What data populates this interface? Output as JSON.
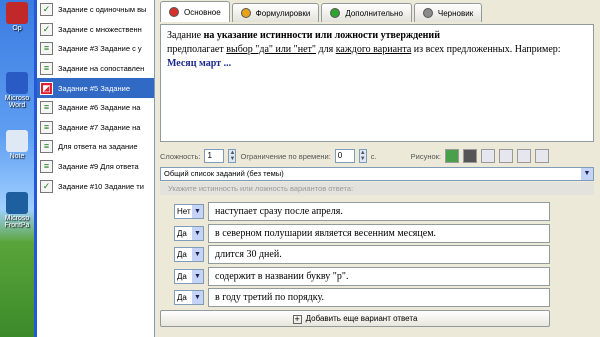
{
  "desktop": {
    "icons": [
      {
        "label": "Op"
      },
      {
        "label": "Microso Word"
      },
      {
        "label": "Note"
      },
      {
        "label": "Microso FrontPa"
      }
    ]
  },
  "task_list": {
    "items": [
      {
        "label": "Задание с одиночным вы"
      },
      {
        "label": "Задание с множественн"
      },
      {
        "label": "Задание #3 Задание с у"
      },
      {
        "label": "Задание на сопоставлен"
      },
      {
        "label": "Задание #5 Задание",
        "selected": true
      },
      {
        "label": "Задание #6 Задание на"
      },
      {
        "label": "Задание #7 Задание на"
      },
      {
        "label": "Для ответа на задание"
      },
      {
        "label": "Задание #9 Для ответа"
      },
      {
        "label": "Задание #10 Задание ти"
      }
    ]
  },
  "tabs": [
    {
      "label": "Основное",
      "color": "#d8302a",
      "active": true
    },
    {
      "label": "Формулировки",
      "color": "#e8a21a"
    },
    {
      "label": "Дополнительно",
      "color": "#2fa32f"
    },
    {
      "label": "Черновик",
      "color": "#8a8a8a"
    }
  ],
  "editor": {
    "p1": "Задание ",
    "p1_bold": "на указание истинности или ложности утверждений",
    "p2": " предполагает ",
    "p2_u1": "выбор \"да\" или \"нет\"",
    "p3": " для ",
    "p3_u2": "каждого варианта",
    "p4": " из всех предложенных. Например:",
    "example": "Месяц март ..."
  },
  "props": {
    "complexity_label": "Сложность:",
    "complexity_value": "1",
    "time_limit_label": "Ограничение по времени:",
    "time_value": "0",
    "seconds_label": "с.",
    "picture_label": "Рисунок:"
  },
  "topic_select": {
    "value": "Общий список заданий (без темы)"
  },
  "hint": "Укажите истинность или ложность вариантов ответа:",
  "answers": [
    {
      "choice": "Нет",
      "text": "наступает сразу после апреля."
    },
    {
      "choice": "Да",
      "text": "в северном полушарии является весенним месяцем."
    },
    {
      "choice": "Да",
      "text": "длится 30 дней."
    },
    {
      "choice": "Да",
      "text": "содержит в названии букву \"р\"."
    },
    {
      "choice": "Да",
      "text": "в году третий по порядку."
    }
  ],
  "add_button": {
    "label": "Добавить еще вариант ответа"
  }
}
